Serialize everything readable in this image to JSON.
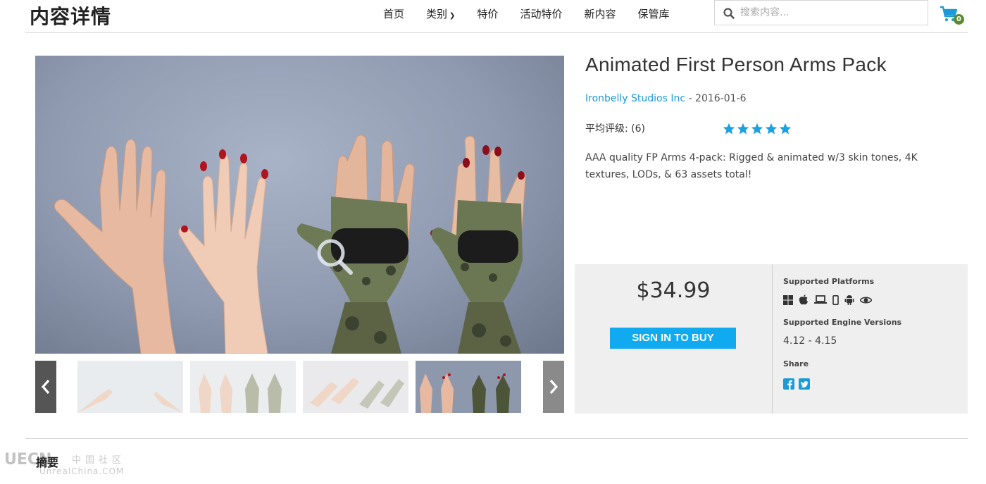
{
  "header": {
    "title": "内容详情",
    "nav": [
      {
        "label": "首页"
      },
      {
        "label": "类别",
        "dropdown": true
      },
      {
        "label": "特价"
      },
      {
        "label": "活动特价"
      },
      {
        "label": "新内容"
      },
      {
        "label": "保管库"
      }
    ],
    "search_placeholder": "搜索内容...",
    "cart_count": "0"
  },
  "product": {
    "title": "Animated First Person Arms Pack",
    "seller": "Ironbelly Studios Inc",
    "separator": " - ",
    "date": "2016-01-6",
    "rating_label": "平均评级:",
    "rating_count": "(6)",
    "rating_stars": 5,
    "description": "AAA quality FP Arms 4-pack: Rigged & animated w/3 skin tones, 4K textures, LODs, & 63 assets total!"
  },
  "purchase": {
    "price": "$34.99",
    "buy_label": "SIGN IN TO BUY",
    "platforms_heading": "Supported Platforms",
    "platforms": [
      "windows-icon",
      "apple-icon",
      "laptop-icon",
      "mobile-icon",
      "android-icon",
      "eye-icon"
    ],
    "engine_heading": "Supported Engine Versions",
    "engine_versions": "4.12 - 4.15",
    "share_heading": "Share",
    "share": [
      "facebook-icon",
      "twitter-icon"
    ]
  },
  "section": {
    "summary_label": "摘要"
  },
  "watermark": {
    "logo": "UECN",
    "cn": "中国社区",
    "site": "UnrealChina.COM"
  },
  "colors": {
    "accent": "#1d9ad6",
    "buy_button": "#0faaf0",
    "star": "#1aa1e0",
    "cart_badge": "#5a8a2c"
  }
}
